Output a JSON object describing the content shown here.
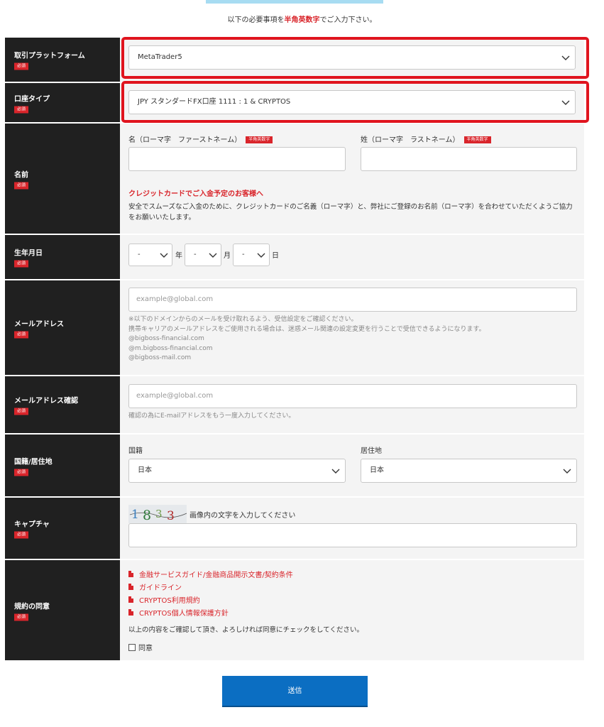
{
  "intro": {
    "before": "以下の必要事項を",
    "emphasis": "半角英数字",
    "after": "でご入力下さい。"
  },
  "required_badge": "必須",
  "platform": {
    "label": "取引プラットフォーム",
    "value": "MetaTrader5"
  },
  "account_type": {
    "label": "口座タイプ",
    "value": "JPY スタンダードFX口座 1111 : 1 & CRYPTOS"
  },
  "name": {
    "label": "名前",
    "first_label": "名（ローマ字　ファーストネーム）",
    "last_label": "姓（ローマ字　ラストネーム）",
    "tag": "半角英数字",
    "first_value": "",
    "last_value": "",
    "card_note_title": "クレジットカードでご入金予定のお客様へ",
    "card_note_body_1": "安全でスムーズなご入金のために、クレジットカードのご名義（ローマ字）と、弊社にご登録のお名前（ローマ字）を合わせていただくようご協力",
    "card_note_body_2": "をお願いいたします。"
  },
  "birthdate": {
    "label": "生年月日",
    "year_value": "-",
    "year_unit": "年",
    "month_value": "-",
    "month_unit": "月",
    "day_value": "-",
    "day_unit": "日"
  },
  "email": {
    "label": "メールアドレス",
    "placeholder": "example@global.com",
    "notes": [
      "※以下のドメインからのメールを受け取れるよう、受信設定をご確認ください。",
      "携帯キャリアのメールアドレスをご使用される場合は、迷惑メール関連の設定変更を行うことで受信できるようになります。",
      "@bigboss-financial.com",
      "@m.bigboss-financial.com",
      "@bigboss-mail.com"
    ]
  },
  "email_confirm": {
    "label": "メールアドレス確認",
    "placeholder": "example@global.com",
    "note": "確認の為にE-mailアドレスをもう一度入力してください。"
  },
  "nationality": {
    "label": "国籍/居住地",
    "nationality_label": "国籍",
    "nationality_value": "日本",
    "residence_label": "居住地",
    "residence_value": "日本"
  },
  "captcha": {
    "label": "キャプチャ",
    "image_text": "1833",
    "instruction": "画像内の文字を入力してください",
    "value": ""
  },
  "terms": {
    "label": "規約の同意",
    "links": [
      "金融サービスガイド/金融商品開示文書/契約条件",
      "ガイドライン",
      "CRYPTOS利用規約",
      "CRYPTOS個人情報保護方針"
    ],
    "confirm_text": "以上の内容をご確認して頂き、よろしければ同意にチェックをしてください。",
    "agree_label": "同意",
    "agree_checked": false
  },
  "submit_label": "送信",
  "colors": {
    "accent_red": "#d9252b",
    "highlight_red": "#e0141e",
    "submit_blue": "#0b6ec2",
    "label_bg": "#202020"
  }
}
